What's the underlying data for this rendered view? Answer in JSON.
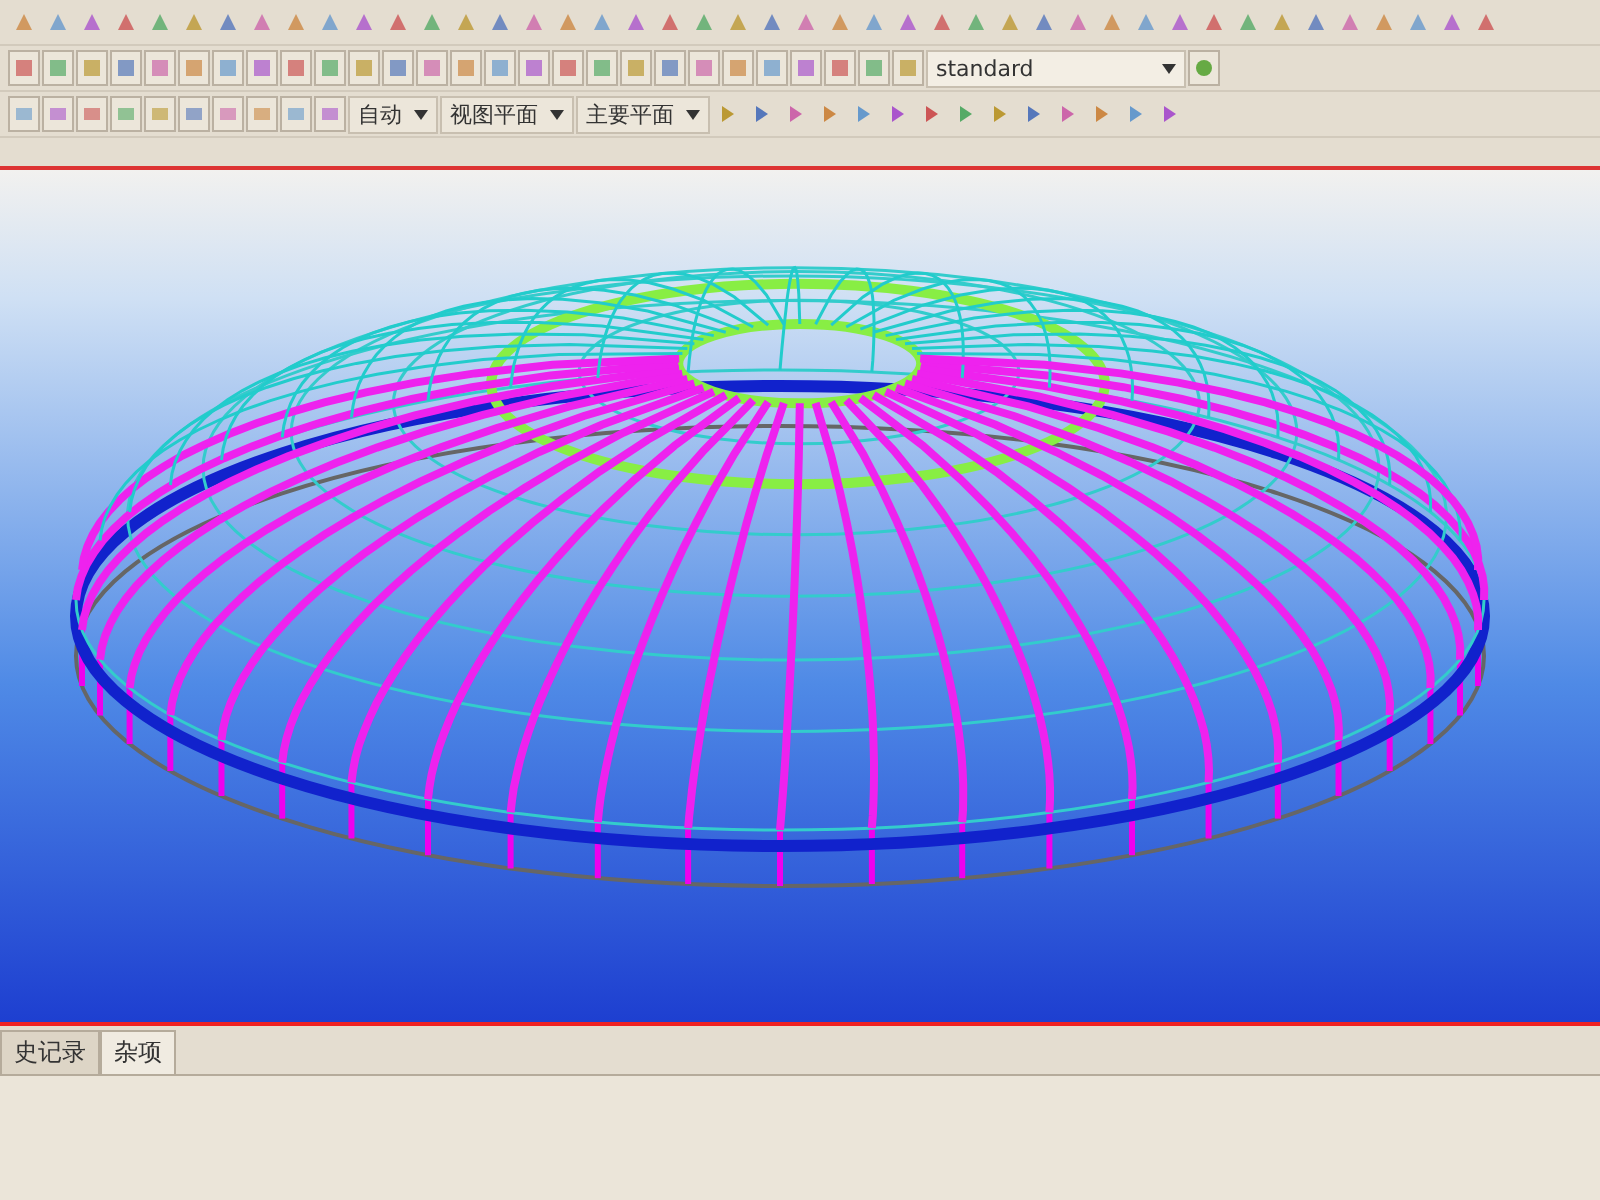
{
  "toolbar": {
    "combos": [
      {
        "value": "自动"
      },
      {
        "value": "视图平面"
      },
      {
        "value": "主要平面"
      }
    ],
    "style_combo": {
      "value": "standard"
    }
  },
  "tabs": [
    {
      "label": "史记录",
      "selected": false
    },
    {
      "label": "杂项",
      "selected": true
    }
  ]
}
